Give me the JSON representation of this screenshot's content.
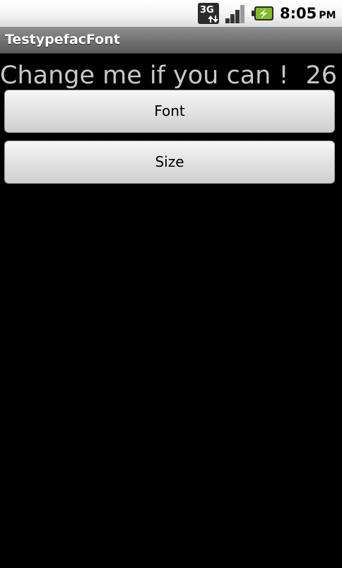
{
  "status_bar": {
    "network_label": "3G",
    "time": "8:05",
    "ampm": "PM",
    "icons": [
      "3g-data-icon",
      "signal-strength-icon",
      "battery-charging-icon"
    ]
  },
  "app": {
    "title": "TestypefacFont"
  },
  "main": {
    "sample_text": "Change me if you can !",
    "size_value": "26",
    "font_button_label": "Font",
    "size_button_label": "Size"
  },
  "colors": {
    "background": "#000000",
    "title_bar": "#6e6e6e",
    "sample_text": "#c8c8c8",
    "battery_accent": "#7ec01e"
  }
}
